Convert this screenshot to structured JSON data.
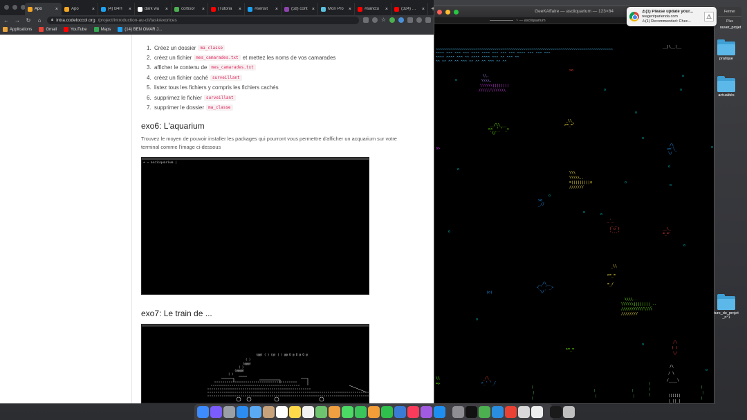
{
  "browser": {
    "tabs": [
      {
        "label": "Apo",
        "color": "#f5a623",
        "active": true
      },
      {
        "label": "Apo",
        "color": "#f5a623"
      },
      {
        "label": "(4) B4H",
        "color": "#1da1f2"
      },
      {
        "label": "dark wa",
        "color": "#ffffff"
      },
      {
        "label": "cortisor",
        "color": "#4caf50"
      },
      {
        "label": "(Tutoria",
        "color": "#ff0000"
      },
      {
        "label": "#sensit",
        "color": "#1da1f2"
      },
      {
        "label": "(58) cont",
        "color": "#8e44ad"
      },
      {
        "label": "Mon Pro",
        "color": "#5bc0de"
      },
      {
        "label": "#sanctu",
        "color": "#ff0000"
      },
      {
        "label": "(324) …",
        "color": "#ff0000"
      }
    ],
    "new_tab": "+",
    "url_host": "intra.codeloccol.org",
    "url_path": "/project/introduction-au-cli/task/exorices",
    "nav": {
      "back": "←",
      "forward": "→",
      "reload": "↻",
      "home": "⌂"
    },
    "star": "☆",
    "bookmarks": [
      {
        "label": "Applications",
        "color": "#e8a33d"
      },
      {
        "label": "Gmail",
        "color": "#ea4335"
      },
      {
        "label": "YouTube",
        "color": "#ff0000"
      },
      {
        "label": "Maps",
        "color": "#34a853"
      },
      {
        "label": "(14) BEN OMAR J...",
        "color": "#1da1f2"
      }
    ]
  },
  "content": {
    "steps": [
      {
        "num": "1.",
        "before": "Créez un dossier",
        "code": "ma_classe",
        "after": ""
      },
      {
        "num": "2.",
        "before": "créez un fichier",
        "code": "mes_camarades.txt",
        "after": "et mettez les noms de vos camarades"
      },
      {
        "num": "3.",
        "before": "afficher le contenu de",
        "code": "mes_camarades.txt",
        "after": ""
      },
      {
        "num": "4.",
        "before": "créez un fichier caché",
        "code": "surveillant",
        "after": ""
      },
      {
        "num": "5.",
        "before": "listez tous les fichiers y compris les fichiers cachés",
        "code": "",
        "after": ""
      },
      {
        "num": "6.",
        "before": "supprimez le fichier",
        "code": "surveillant",
        "after": ""
      },
      {
        "num": "7.",
        "before": "supprimer le dossier",
        "code": "ma_classe",
        "after": ""
      }
    ],
    "exo6_title": "exo6: L'aquarium",
    "exo6_text": "Trouvez le moyen de pouvoir installer les packages qui pourront vous permettre d'afficher un acquarium sur votre terminal comme l'image ci-dessous",
    "exo6_prompt": "➜ ~ asciiquarium |",
    "exo7_title": "exo7: Le train de ..."
  },
  "terminal": {
    "title": "GeeKAffaire — asciiquarium — 123×84",
    "tab_label": "~ — asciiquarium"
  },
  "notification": {
    "title": "⚠(1) Please update your...",
    "line2": "reagentparienda.com",
    "line3": "⚠(1) Recommended: Chec...",
    "warn": "⚠",
    "side_top": "Fermer",
    "side_bottom": "Plus"
  },
  "desktop": {
    "top_label": "ouver_projet",
    "icons": [
      {
        "label": "pratique"
      },
      {
        "label": "actualités"
      },
      {
        "label": "ture_de_projet _n°1"
      }
    ]
  },
  "dock": {
    "apps": [
      {
        "name": "finder-icon",
        "color": "#3d8bfd"
      },
      {
        "name": "siri-icon",
        "color": "#7a5cff"
      },
      {
        "name": "launchpad-icon",
        "color": "#9aa0a6"
      },
      {
        "name": "safari-icon",
        "color": "#2d8cf0"
      },
      {
        "name": "mail-icon",
        "color": "#5aa9f5"
      },
      {
        "name": "contacts-icon",
        "color": "#c8a27a"
      },
      {
        "name": "calendar-icon",
        "color": "#ffffff"
      },
      {
        "name": "notes-icon",
        "color": "#ffd94a"
      },
      {
        "name": "reminders-icon",
        "color": "#f2f2f2"
      },
      {
        "name": "maps-icon",
        "color": "#6ec46e"
      },
      {
        "name": "photos-icon",
        "color": "#f0a040"
      },
      {
        "name": "messages-icon",
        "color": "#4cd964"
      },
      {
        "name": "facetime-icon",
        "color": "#3ac45a"
      },
      {
        "name": "pages-icon",
        "color": "#f29d38"
      },
      {
        "name": "numbers-icon",
        "color": "#2fbf4b"
      },
      {
        "name": "keynote-icon",
        "color": "#3a7bd5"
      },
      {
        "name": "music-icon",
        "color": "#fa3c5a"
      },
      {
        "name": "podcasts-icon",
        "color": "#a05be0"
      },
      {
        "name": "appstore-icon",
        "color": "#1f8ef1"
      },
      {
        "name": "settings-icon",
        "color": "#8e8e93"
      },
      {
        "name": "terminal-icon",
        "color": "#111111"
      },
      {
        "name": "torrent-icon",
        "color": "#4caf50"
      },
      {
        "name": "vscode-icon",
        "color": "#2b8ddf"
      },
      {
        "name": "chrome-icon",
        "color": "#e94235"
      },
      {
        "name": "preview-icon",
        "color": "#d9d9d9"
      },
      {
        "name": "textedit-icon",
        "color": "#eeeeee"
      },
      {
        "name": "terminal2-icon",
        "color": "#1a1a1a"
      },
      {
        "name": "trash-icon",
        "color": "#bfbfbf"
      }
    ]
  }
}
